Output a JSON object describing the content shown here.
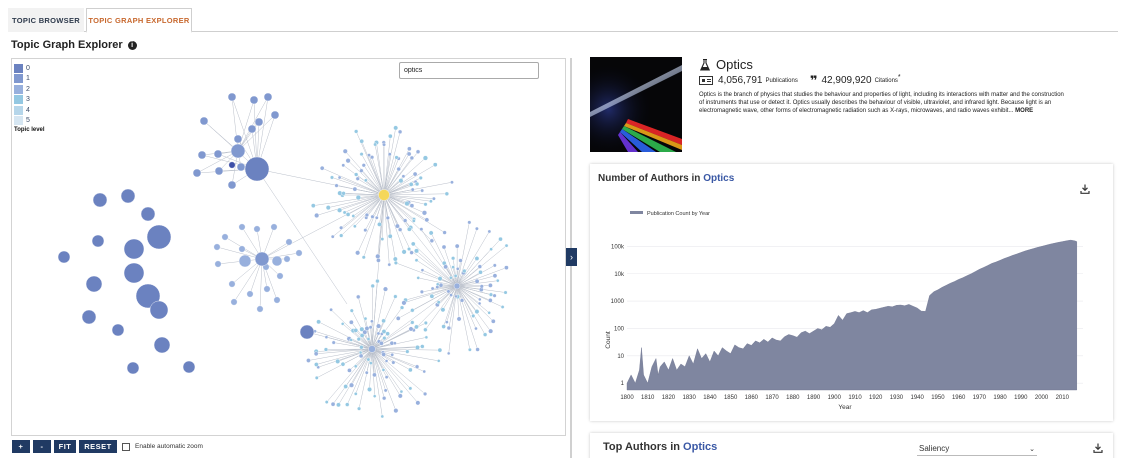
{
  "tabs": [
    {
      "label": "TOPIC BROWSER",
      "active": false
    },
    {
      "label": "TOPIC GRAPH EXPLORER",
      "active": true
    }
  ],
  "page_title": "Topic Graph Explorer",
  "legend": {
    "title": "Topic level",
    "levels": [
      {
        "label": "0",
        "color": "#6b82c0"
      },
      {
        "label": "1",
        "color": "#8098cf"
      },
      {
        "label": "2",
        "color": "#98b0dd"
      },
      {
        "label": "3",
        "color": "#94c8e2"
      },
      {
        "label": "4",
        "color": "#b6d6ea"
      },
      {
        "label": "5",
        "color": "#d6e6f2"
      }
    ]
  },
  "graph_search": {
    "value": "optics"
  },
  "graph_controls": {
    "zoom_in": "+",
    "zoom_out": "-",
    "fit": "FIT",
    "reset": "RESET",
    "auto_zoom_label": "Enable automatic zoom"
  },
  "toggle_icon": "›",
  "topic": {
    "name": "Optics",
    "publications": "4,056,791",
    "publications_label": "Publications",
    "citations": "42,909,920",
    "citations_label": "Citations",
    "citations_mark": "*",
    "description": "Optics is the branch of physics that studies the behaviour and properties of light, including its interactions with matter and the construction of instruments that use or detect it. Optics usually describes the behaviour of visible, ultraviolet, and infrared light. Because light is an electromagnetic wave, other forms of electromagnetic radiation such as X-rays, microwaves, and radio waves exhibit...",
    "more_label": "MORE"
  },
  "authors_card": {
    "title_prefix": "Number of Authors in",
    "title_topic": "Optics"
  },
  "top_authors_card": {
    "title_prefix": "Top Authors in",
    "title_topic": "Optics",
    "sort_value": "Saliency"
  },
  "colors": {
    "accent": "#c8692f",
    "navy": "#203a63",
    "link": "#3a58a5",
    "area": "#7f86a0",
    "highlight_node": "#f5d75a"
  },
  "chart_data": {
    "type": "area",
    "title": "Number of Authors in Optics",
    "legend": [
      "Publication Count by Year"
    ],
    "legend_position": "top-left",
    "xlabel": "Year",
    "ylabel": "Count",
    "y_scale": "log",
    "x_range": [
      1800,
      2020
    ],
    "y_ticks": [
      1,
      10,
      100,
      1000,
      10000,
      100000
    ],
    "y_tick_labels": [
      "1",
      "10",
      "100",
      "1000",
      "10k",
      "100k"
    ],
    "x_ticks": [
      1800,
      1810,
      1820,
      1830,
      1840,
      1850,
      1860,
      1870,
      1880,
      1890,
      1900,
      1910,
      1920,
      1930,
      1940,
      1950,
      1960,
      1970,
      1980,
      1990,
      2000,
      2010
    ],
    "series": [
      {
        "name": "Publication Count by Year",
        "x": [
          1800,
          1802,
          1804,
          1806,
          1807,
          1808,
          1810,
          1812,
          1814,
          1815,
          1816,
          1818,
          1820,
          1822,
          1824,
          1826,
          1828,
          1830,
          1832,
          1834,
          1836,
          1838,
          1840,
          1842,
          1844,
          1846,
          1848,
          1850,
          1852,
          1854,
          1856,
          1858,
          1860,
          1862,
          1864,
          1866,
          1868,
          1870,
          1872,
          1874,
          1876,
          1878,
          1880,
          1882,
          1884,
          1886,
          1888,
          1890,
          1892,
          1894,
          1896,
          1898,
          1900,
          1902,
          1904,
          1906,
          1908,
          1910,
          1912,
          1914,
          1916,
          1918,
          1920,
          1922,
          1924,
          1926,
          1928,
          1930,
          1932,
          1934,
          1936,
          1938,
          1940,
          1942,
          1944,
          1946,
          1948,
          1950,
          1952,
          1954,
          1956,
          1958,
          1960,
          1962,
          1964,
          1966,
          1968,
          1970,
          1972,
          1974,
          1976,
          1978,
          1980,
          1982,
          1984,
          1986,
          1988,
          1990,
          1992,
          1994,
          1996,
          1998,
          2000,
          2002,
          2004,
          2006,
          2008,
          2010,
          2012,
          2014,
          2016,
          2017
        ],
        "values": [
          1,
          2,
          1,
          3,
          20,
          2,
          1,
          4,
          8,
          2,
          4,
          6,
          3,
          8,
          3,
          5,
          4,
          10,
          5,
          18,
          8,
          12,
          6,
          15,
          10,
          20,
          15,
          12,
          25,
          20,
          18,
          28,
          24,
          35,
          30,
          40,
          32,
          45,
          38,
          35,
          50,
          60,
          55,
          48,
          70,
          80,
          65,
          80,
          100,
          90,
          120,
          110,
          150,
          300,
          200,
          350,
          380,
          420,
          380,
          450,
          380,
          480,
          500,
          550,
          600,
          650,
          620,
          700,
          720,
          680,
          760,
          650,
          560,
          430,
          420,
          1600,
          2200,
          2600,
          3200,
          3800,
          4500,
          5200,
          6200,
          7200,
          8500,
          10000,
          12000,
          14500,
          17000,
          20000,
          24000,
          27000,
          31000,
          36000,
          41000,
          47000,
          53000,
          60000,
          68000,
          75000,
          83000,
          92000,
          100000,
          110000,
          120000,
          130000,
          140000,
          150000,
          160000,
          170000,
          160000,
          150000
        ]
      }
    ]
  }
}
